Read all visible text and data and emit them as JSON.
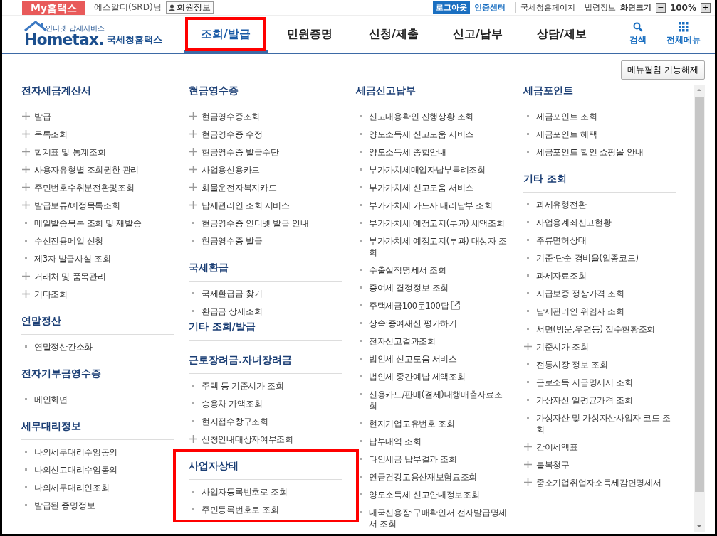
{
  "top_bar": {
    "brand": "My홈택스",
    "user": "에스알디(SRD)님",
    "member_button": "회원정보",
    "logout": "로그아웃",
    "cert_center": "인증센터",
    "links": [
      "국세청홈페이지",
      "법령정보"
    ],
    "zoom_label": "화면크기",
    "zoom_minus": "−",
    "zoom_value": "100%",
    "zoom_plus": "+"
  },
  "header": {
    "logo_tagline": "인터넷 납세서비스",
    "logo_word": "Hometax.",
    "logo_name": "국세청홈택스",
    "nav": [
      {
        "label": "조회/발급",
        "selected": true,
        "highlighted": true
      },
      {
        "label": "민원증명",
        "selected": false,
        "highlighted": false
      },
      {
        "label": "신청/제출",
        "selected": false,
        "highlighted": false
      },
      {
        "label": "신고/납부",
        "selected": false,
        "highlighted": false
      },
      {
        "label": "상담/제보",
        "selected": false,
        "highlighted": false
      }
    ],
    "search": "검색",
    "all_menu": "전체메뉴"
  },
  "menu_toggle_button": "메뉴펼침 기능해제",
  "columns": [
    [
      {
        "title": "전자세금계산서",
        "highlighted": false,
        "items": [
          {
            "label": "발급",
            "kind": "expand"
          },
          {
            "label": "목록조회",
            "kind": "expand"
          },
          {
            "label": "합계표 및 통계조회",
            "kind": "expand"
          },
          {
            "label": "사용자유형별 조회권한 관리",
            "kind": "expand"
          },
          {
            "label": "주민번호수취분전환및조회",
            "kind": "expand"
          },
          {
            "label": "발급보류/예정목록조회",
            "kind": "expand"
          },
          {
            "label": "메일발송목록 조회 및 재발송",
            "kind": "bullet"
          },
          {
            "label": "수신전용메일 신청",
            "kind": "bullet"
          },
          {
            "label": "제3자 발급사실 조회",
            "kind": "bullet"
          },
          {
            "label": "거래처 및 품목관리",
            "kind": "expand"
          },
          {
            "label": "기타조회",
            "kind": "expand"
          }
        ]
      },
      {
        "title": "연말정산",
        "highlighted": false,
        "items": [
          {
            "label": "연말정산간소화",
            "kind": "bullet"
          }
        ]
      },
      {
        "title": "전자기부금영수증",
        "highlighted": false,
        "items": [
          {
            "label": "메인화면",
            "kind": "bullet"
          }
        ]
      },
      {
        "title": "세무대리정보",
        "highlighted": false,
        "items": [
          {
            "label": "나의세무대리수임동의",
            "kind": "bullet"
          },
          {
            "label": "나의신고대리수임동의",
            "kind": "bullet"
          },
          {
            "label": "나의세무대리인조회",
            "kind": "bullet"
          },
          {
            "label": "발급된 증명정보",
            "kind": "bullet"
          }
        ]
      }
    ],
    [
      {
        "title": "현금영수증",
        "highlighted": false,
        "items": [
          {
            "label": "현금영수증조회",
            "kind": "expand"
          },
          {
            "label": "현금영수증 수정",
            "kind": "expand"
          },
          {
            "label": "현금영수증 발급수단",
            "kind": "expand"
          },
          {
            "label": "사업용신용카드",
            "kind": "expand"
          },
          {
            "label": "화물운전자복지카드",
            "kind": "expand"
          },
          {
            "label": "납세관리인 조회 서비스",
            "kind": "expand"
          },
          {
            "label": "현금영수증 인터넷 발급 안내",
            "kind": "bullet"
          },
          {
            "label": "현금영수증 발급",
            "kind": "bullet"
          }
        ]
      },
      {
        "title": "국세환급",
        "highlighted": false,
        "items": [
          {
            "label": "국세환급금 찾기",
            "kind": "bullet"
          },
          {
            "label": "환급금 상세조회",
            "kind": "bullet"
          }
        ]
      },
      {
        "title": "기타 조회/발급",
        "highlighted": false
      },
      {
        "title": "근로장려금.자녀장려금",
        "highlighted": false,
        "items": [
          {
            "label": "주택 등 기준시가 조회",
            "kind": "bullet"
          },
          {
            "label": "승용차 가액조회",
            "kind": "bullet"
          },
          {
            "label": "현지접수창구조회",
            "kind": "bullet"
          },
          {
            "label": "신청안내대상자여부조회",
            "kind": "expand"
          }
        ]
      },
      {
        "title": "사업자상태",
        "highlighted": true,
        "items": [
          {
            "label": "사업자등록번호로 조회",
            "kind": "bullet"
          },
          {
            "label": "주민등록번호로 조회",
            "kind": "bullet"
          }
        ]
      }
    ],
    [
      {
        "title": "세금신고납부",
        "highlighted": false,
        "items": [
          {
            "label": "신고내용확인 진행상황 조회",
            "kind": "bullet"
          },
          {
            "label": "양도소득세 신고도움 서비스",
            "kind": "bullet"
          },
          {
            "label": "양도소득세 종합안내",
            "kind": "bullet"
          },
          {
            "label": "부가가치세매입자납부특례조회",
            "kind": "bullet"
          },
          {
            "label": "부가가치세 신고도움 서비스",
            "kind": "bullet"
          },
          {
            "label": "부가가치세 카드사 대리납부 조회",
            "kind": "bullet"
          },
          {
            "label": "부가가치세 예정고지(부과) 세액조회",
            "kind": "bullet"
          },
          {
            "label": "부가가치세 예정고지(부과) 대상자 조회",
            "kind": "bullet"
          },
          {
            "label": "수출실적명세서 조회",
            "kind": "bullet"
          },
          {
            "label": "증여세 결정정보 조회",
            "kind": "bullet"
          },
          {
            "label": "주택세금100문100답",
            "kind": "bullet",
            "external": true
          },
          {
            "label": "상속·증여재산 평가하기",
            "kind": "bullet"
          },
          {
            "label": "전자신고결과조회",
            "kind": "bullet"
          },
          {
            "label": "법인세 신고도움 서비스",
            "kind": "bullet"
          },
          {
            "label": "법인세 중간예납 세액조회",
            "kind": "bullet"
          },
          {
            "label": "신용카드/판매(결제)대행매출자료조회",
            "kind": "bullet"
          },
          {
            "label": "현지기업고유번호 조회",
            "kind": "bullet"
          },
          {
            "label": "납부내역 조회",
            "kind": "bullet"
          },
          {
            "label": "타인세금 납부결과 조회",
            "kind": "bullet"
          },
          {
            "label": "연금건강고용산재보험료조회",
            "kind": "bullet"
          },
          {
            "label": "양도소득세 신고안내정보조회",
            "kind": "bullet"
          },
          {
            "label": "내국신용장·구매확인서 전자발급명세서 조회",
            "kind": "bullet"
          }
        ]
      }
    ],
    [
      {
        "title": "세금포인트",
        "highlighted": false,
        "items": [
          {
            "label": "세금포인트 조회",
            "kind": "bullet"
          },
          {
            "label": "세금포인트 혜택",
            "kind": "bullet"
          },
          {
            "label": "세금포인트 할인 쇼핑몰 안내",
            "kind": "bullet"
          }
        ]
      },
      {
        "title": "기타 조회",
        "highlighted": false,
        "items": [
          {
            "label": "과세유형전환",
            "kind": "bullet"
          },
          {
            "label": "사업용계좌신고현황",
            "kind": "bullet"
          },
          {
            "label": "주류면허상태",
            "kind": "bullet"
          },
          {
            "label": "기준·단순 경비율(업종코드)",
            "kind": "bullet"
          },
          {
            "label": "과세자료조회",
            "kind": "bullet"
          },
          {
            "label": "지급보증 정상가격 조회",
            "kind": "bullet"
          },
          {
            "label": "납세관리인 위임자 조회",
            "kind": "bullet"
          },
          {
            "label": "서면(방문,우편등) 접수현황조회",
            "kind": "bullet"
          },
          {
            "label": "기준시가 조회",
            "kind": "expand"
          },
          {
            "label": "전통시장 정보 조회",
            "kind": "bullet"
          },
          {
            "label": "근로소득 지급명세서 조회",
            "kind": "bullet"
          },
          {
            "label": "가상자산 일평균가격 조회",
            "kind": "bullet"
          },
          {
            "label": "가상자산 및 가상자산사업자 코드 조회",
            "kind": "bullet"
          },
          {
            "label": "간이세액표",
            "kind": "expand"
          },
          {
            "label": "불복청구",
            "kind": "expand"
          },
          {
            "label": "중소기업취업자소득세감면명세서",
            "kind": "expand"
          }
        ]
      }
    ]
  ]
}
